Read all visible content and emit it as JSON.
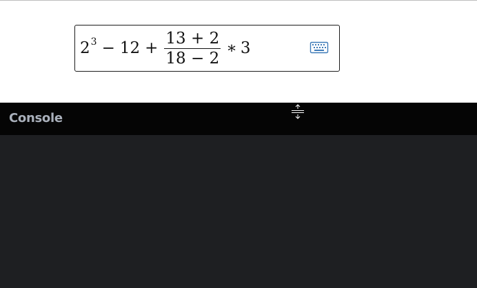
{
  "math_field": {
    "base": "2",
    "exponent": "3",
    "minus": "−",
    "term": "12",
    "plus": "+",
    "numerator": "13 + 2",
    "denominator": "18 − 2",
    "times": "∗",
    "multiplier": "3",
    "keyboard_icon": "keyboard-icon"
  },
  "resize_icon": "split-resize-icon",
  "console": {
    "title": "Console"
  },
  "colors": {
    "console_header_bg": "#050505",
    "console_body_bg": "#1e1f22",
    "console_title": "#a9b0bb",
    "keyboard_icon": "#3d7ab8"
  }
}
